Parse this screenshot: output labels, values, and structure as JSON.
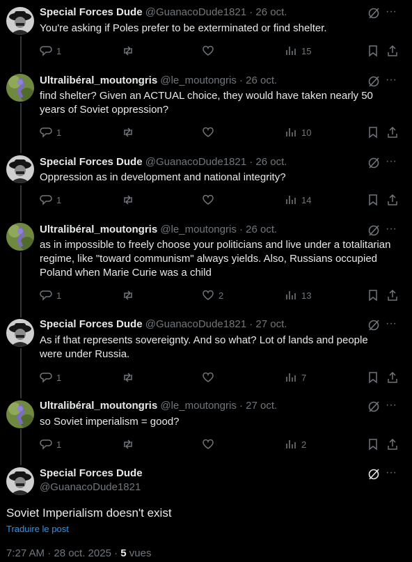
{
  "replies": [
    {
      "name": "Special Forces Dude",
      "handle": "@GuanacoDude1821",
      "sep": "·",
      "date": "26 oct.",
      "text": "You're asking if Poles prefer to be exterminated or find shelter.",
      "reply_count": "1",
      "retweet_count": "",
      "like_count": "",
      "view_count": "15",
      "avatar": "guanaco"
    },
    {
      "name": "Ultralibéral_moutongris",
      "handle": "@le_moutongris",
      "sep": "·",
      "date": "26 oct.",
      "text": "find shelter? Given an ACTUAL choice, they would have taken nearly 50 years of Soviet oppression?",
      "reply_count": "1",
      "retweet_count": "",
      "like_count": "",
      "view_count": "10",
      "avatar": "moutongris"
    },
    {
      "name": "Special Forces Dude",
      "handle": "@GuanacoDude1821",
      "sep": "·",
      "date": "26 oct.",
      "text": "Oppression as in development and national integrity?",
      "reply_count": "1",
      "retweet_count": "",
      "like_count": "",
      "view_count": "14",
      "avatar": "guanaco"
    },
    {
      "name": "Ultralibéral_moutongris",
      "handle": "@le_moutongris",
      "sep": "·",
      "date": "26 oct.",
      "text": "as in impossible to freely choose your politicians and live under a totalitarian regime, like \"toward communism\" always yields. Also, Russians occupied Poland when Marie Curie was a child",
      "reply_count": "1",
      "retweet_count": "",
      "like_count": "2",
      "view_count": "13",
      "avatar": "moutongris"
    },
    {
      "name": "Special Forces Dude",
      "handle": "@GuanacoDude1821",
      "sep": "·",
      "date": "27 oct.",
      "text": "As if that represents sovereignty. And so what? Lot of lands and people were under Russia.",
      "reply_count": "1",
      "retweet_count": "",
      "like_count": "",
      "view_count": "7",
      "avatar": "guanaco"
    },
    {
      "name": "Ultralibéral_moutongris",
      "handle": "@le_moutongris",
      "sep": "·",
      "date": "27 oct.",
      "text": "so Soviet imperialism = good?",
      "reply_count": "1",
      "retweet_count": "",
      "like_count": "",
      "view_count": "2",
      "avatar": "moutongris"
    }
  ],
  "main_tweet": {
    "name": "Special Forces Dude",
    "handle": "@GuanacoDude1821",
    "text": "Soviet Imperialism doesn't exist",
    "translate_label": "Traduire le post",
    "time": "7:27 AM · 28 oct. 2025 · ",
    "views_count": "5",
    "views_label": " vues",
    "avatar": "guanaco"
  },
  "icons": {
    "more": "more-dots-icon",
    "grok": "grok-icon",
    "reply": "reply-icon",
    "retweet": "retweet-icon",
    "like": "heart-icon",
    "views": "views-icon",
    "bookmark": "bookmark-icon",
    "share": "share-icon"
  },
  "colors": {
    "background": "#000000",
    "text": "#e7e9ea",
    "muted": "#71767b",
    "link": "#1d9bf0",
    "thread_line": "#333639"
  }
}
